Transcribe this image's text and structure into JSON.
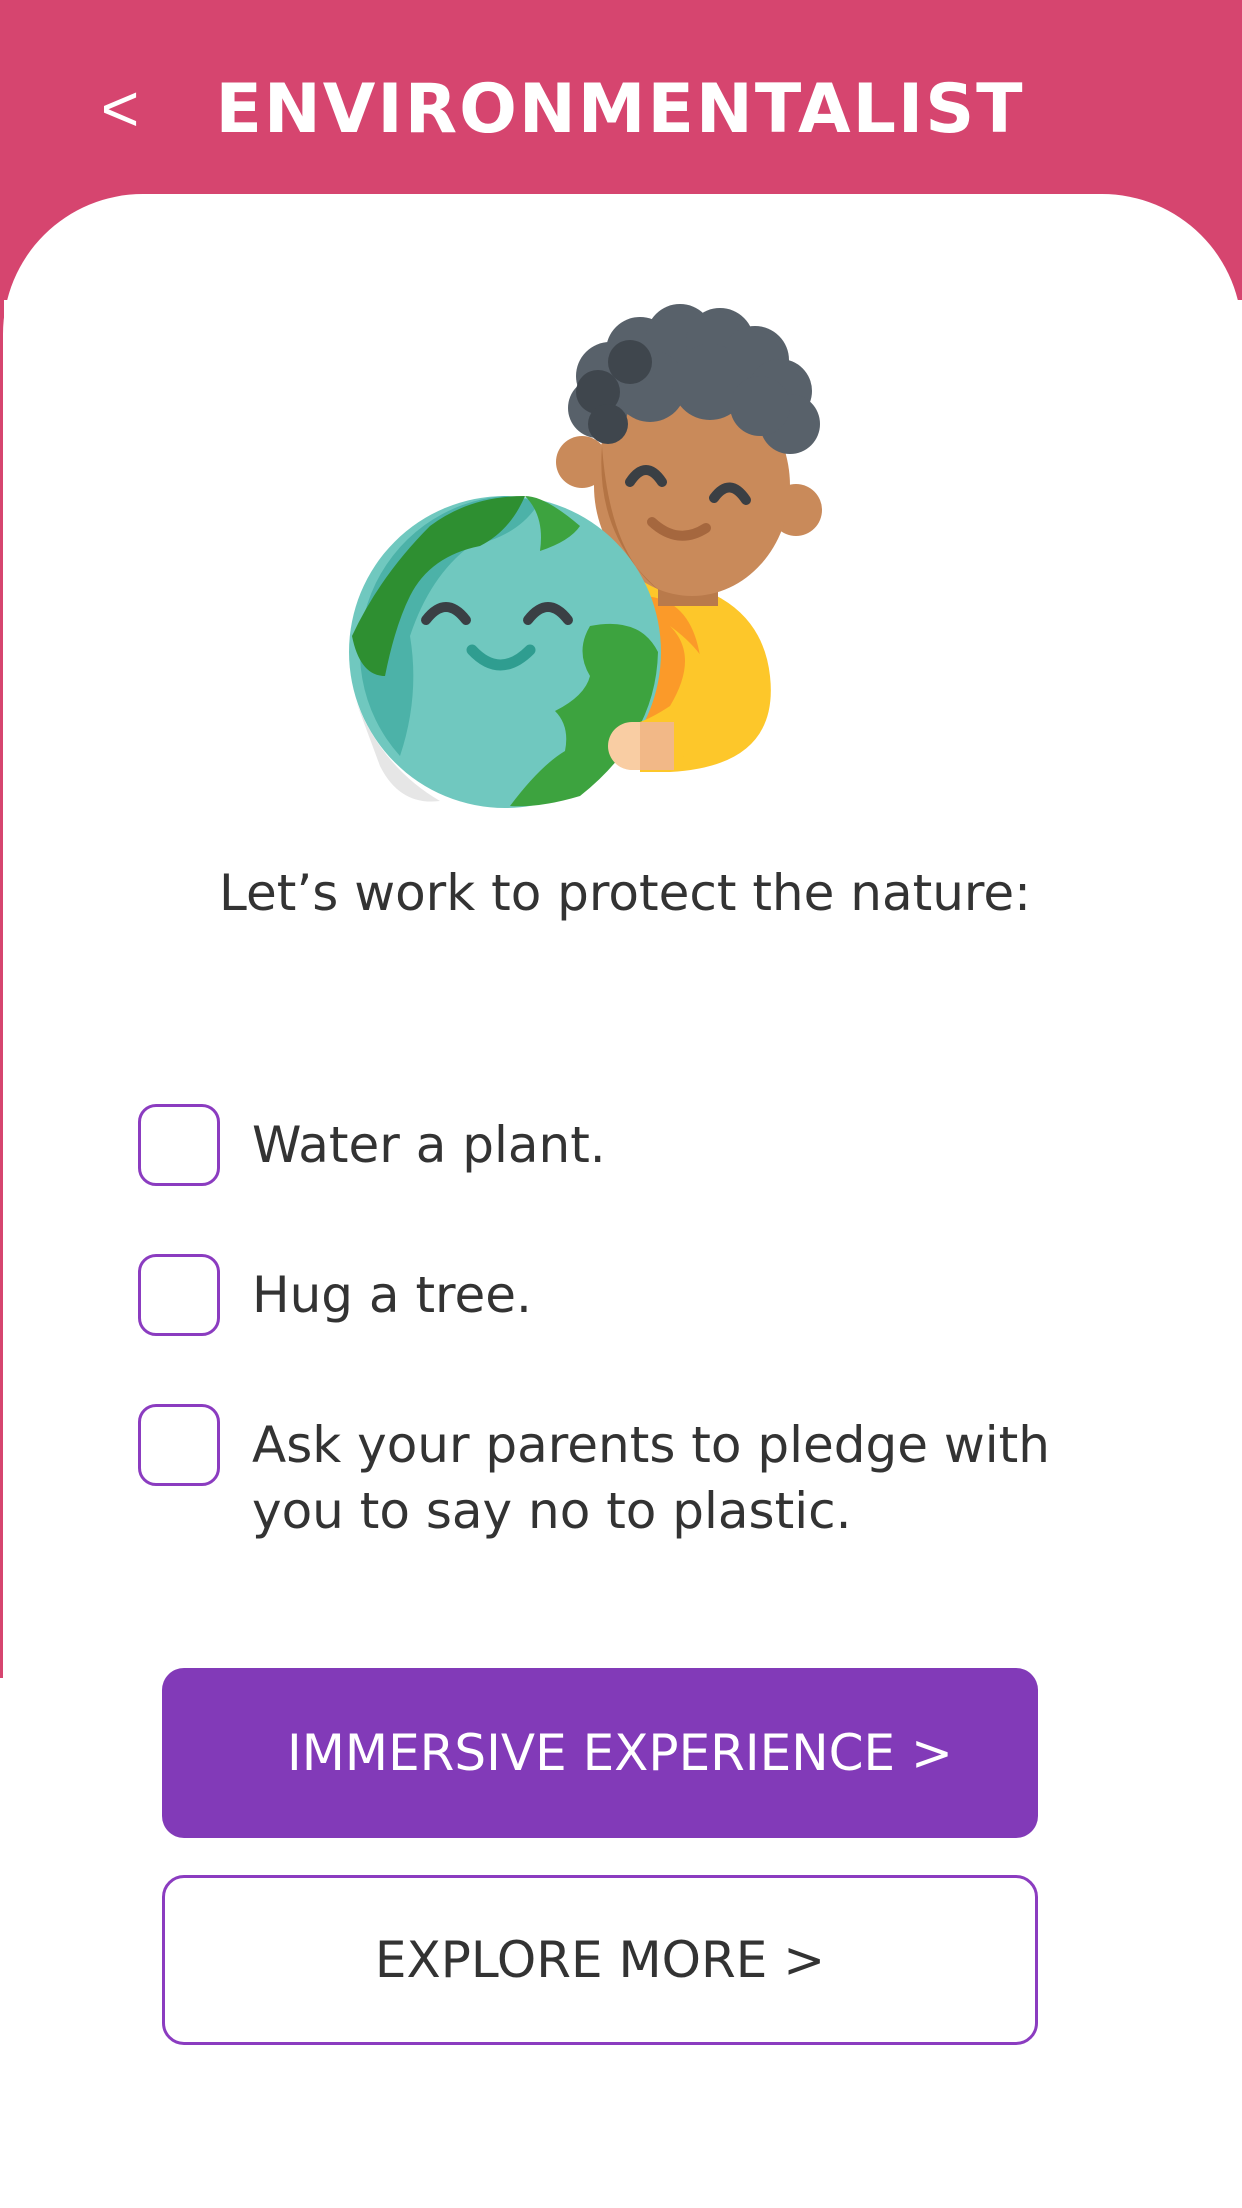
{
  "header": {
    "back_label": "<",
    "title": "ENVIRONMENTALIST",
    "color": "#d6456f"
  },
  "illustration": {
    "icon": "child-hugging-earth-icon"
  },
  "intro": {
    "text": "Let’s work to protect the nature:"
  },
  "tasks": [
    {
      "label": "Water a plant.",
      "checked": false
    },
    {
      "label": "Hug a tree.",
      "checked": false
    },
    {
      "label": "Ask your parents to pledge with you to say no to plastic.",
      "checked": false
    }
  ],
  "actions": {
    "primary_label": "IMMERSIVE EXPERIENCE >",
    "secondary_label": "EXPLORE MORE >",
    "accent_color": "#823ab8"
  }
}
